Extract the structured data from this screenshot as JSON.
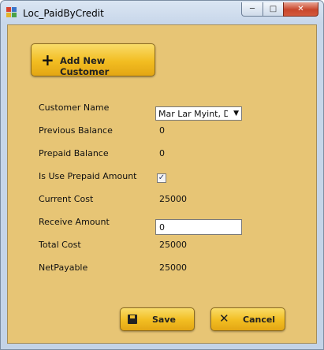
{
  "window": {
    "title": "Loc_PaidByCredit"
  },
  "buttons": {
    "add_customer": "Add New Customer",
    "save": "Save",
    "cancel": "Cancel"
  },
  "form": {
    "customer_name_label": "Customer Name",
    "customer_name_value": "Mar Lar Myint, Daw",
    "previous_balance_label": "Previous Balance",
    "previous_balance_value": "0",
    "prepaid_balance_label": "Prepaid Balance",
    "prepaid_balance_value": "0",
    "use_prepaid_label": "Is Use Prepaid Amount",
    "use_prepaid_checked": true,
    "current_cost_label": "Current Cost",
    "current_cost_value": "25000",
    "receive_amount_label": "Receive Amount",
    "receive_amount_value": "0",
    "total_cost_label": "Total Cost",
    "total_cost_value": "25000",
    "net_payable_label": "NetPayable",
    "net_payable_value": "25000"
  },
  "colors": {
    "client_bg": "#e7c575",
    "button_gold": "#f2bd21"
  }
}
